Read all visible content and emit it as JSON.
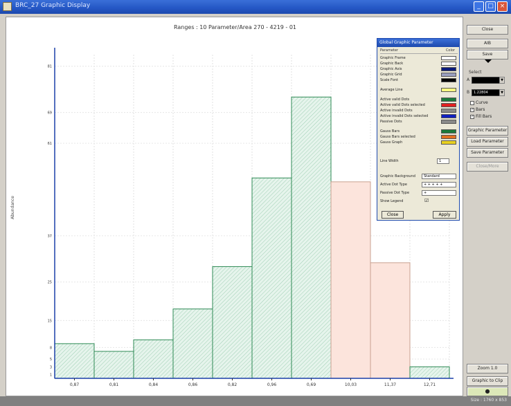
{
  "window": {
    "title": "BRC_27 Graphic Display"
  },
  "plot": {
    "header": "Ranges : 10     Parameter/Area 270 - 4219 - 01",
    "ylabel": "Abundance"
  },
  "chart_data": {
    "type": "bar",
    "categories": [
      "0,87",
      "0,81",
      "0,84",
      "0,86",
      "0,82",
      "0,96",
      "0,69",
      "10,03",
      "11,37",
      "12,71"
    ],
    "values": [
      9,
      7,
      10,
      18,
      29,
      52,
      73,
      51,
      30,
      3
    ],
    "series_status": [
      "valid",
      "valid",
      "valid",
      "valid",
      "valid",
      "valid",
      "valid",
      "invalid",
      "invalid",
      "valid"
    ],
    "ytick_labels": [
      "1",
      "3",
      "5",
      "8",
      "15",
      "25",
      "37",
      "61",
      "69",
      "81"
    ],
    "ylim": [
      0,
      80
    ],
    "colors": {
      "valid_fill": "#d8efe4",
      "valid_stroke": "#2e8a55",
      "invalid_fill": "#fce4dc",
      "invalid_stroke": "#c8a090",
      "axis": "#1a3fa8"
    }
  },
  "right_panel": {
    "buttons": {
      "close": "Close",
      "a": "AIB",
      "save": "Save",
      "graphic_parameter": "Graphic Parameter",
      "load_parameter": "Load Parameter",
      "save_parameter": "Save Parameter",
      "close_more": "Close/More",
      "zoom": "Zoom  1.0",
      "graphic_to_clip": "Graphic to Clip"
    },
    "select_label": "Select",
    "field_a_label": "A",
    "field_b_label": "B",
    "field_b_value": "1.22804",
    "checks": [
      {
        "label": "Curve",
        "checked": false
      },
      {
        "label": "Bars",
        "checked": true
      },
      {
        "label": "Fill Bars",
        "checked": true
      }
    ]
  },
  "status": {
    "text": "Size : 1760 x 853"
  },
  "dialog": {
    "title": "Global Graphic Parameter",
    "col_param": "Parameter",
    "col_color": "Color",
    "rows": [
      {
        "label": "Graphic Frame",
        "color": "#ffffff"
      },
      {
        "label": "Graphic Back",
        "color": "#ffffff"
      },
      {
        "label": "Graphic Axis",
        "color": "#0a1a7a"
      },
      {
        "label": "Graphic Grid",
        "color": "#9aa0c0"
      },
      {
        "label": "Scale Font",
        "color": "#000000"
      },
      {
        "label": "Average Line",
        "color": "#ffff80"
      },
      {
        "label": "Active valid Dots",
        "color": "#1a7a3a"
      },
      {
        "label": "Active valid Dots selected",
        "color": "#e02020"
      },
      {
        "label": "Active invalid Dots",
        "color": "#8a8a8a"
      },
      {
        "label": "Active invalid Dots selected",
        "color": "#1020c0"
      },
      {
        "label": "Passive Dots",
        "color": "#8a8a8a"
      },
      {
        "label": "Gauss Bars",
        "color": "#1a7a3a"
      },
      {
        "label": "Gauss Bars selected",
        "color": "#e07020"
      },
      {
        "label": "Gauss Graph",
        "color": "#e8d020"
      }
    ],
    "line_width_label": "Line Width",
    "line_width_value": "1",
    "graphic_background_label": "Graphic Background",
    "graphic_background_value": "Standard",
    "active_dot_type_label": "Active Dot Type",
    "active_dot_type_value": "+ + + + +",
    "passive_dot_type_label": "Passive Dot Type",
    "passive_dot_type_value": "+",
    "show_legend_label": "Show Legend",
    "close_btn": "Close",
    "apply_btn": "Apply"
  }
}
